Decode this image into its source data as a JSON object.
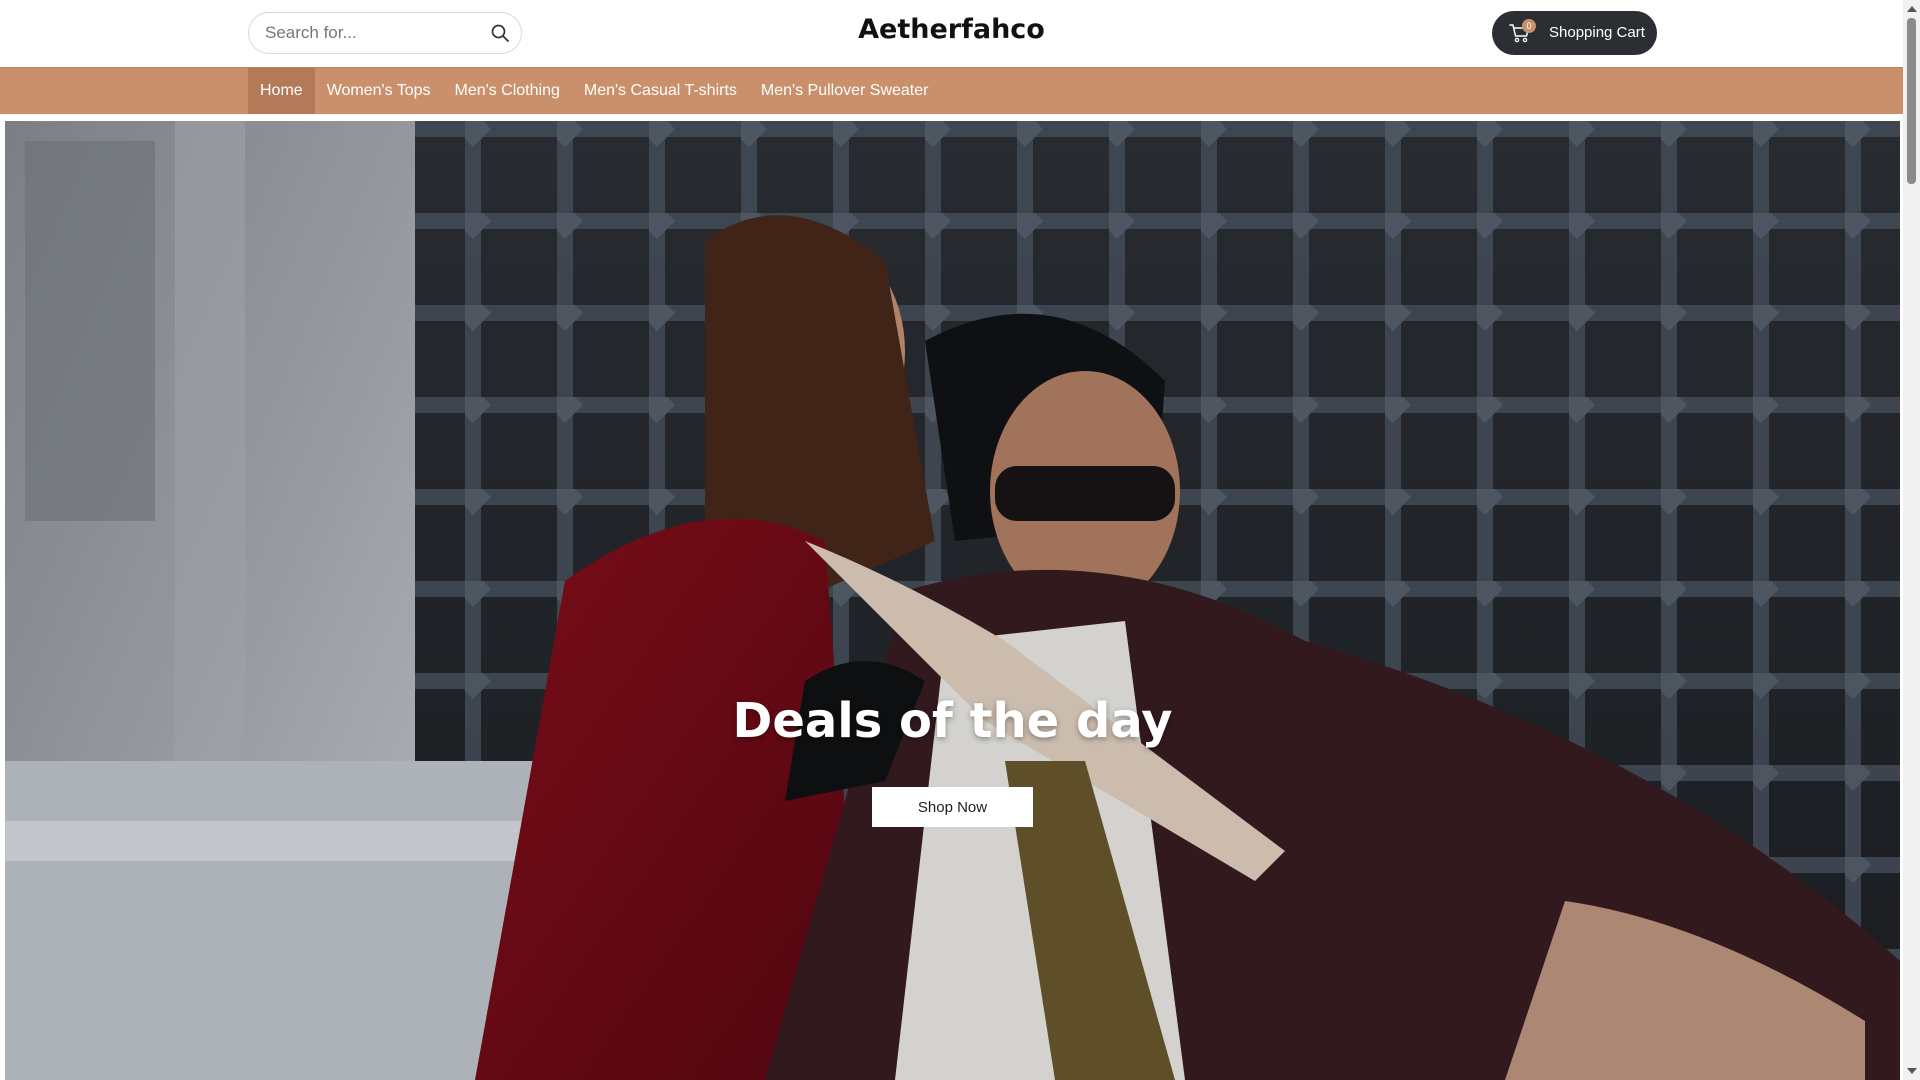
{
  "header": {
    "search": {
      "placeholder": "Search for...",
      "value": "",
      "icon": "search-icon"
    },
    "brand": "Aetherfahco",
    "cart": {
      "label": "Shopping Cart",
      "count": "0",
      "icon": "cart-icon"
    }
  },
  "nav": {
    "items": [
      {
        "label": "Home",
        "active": true
      },
      {
        "label": "Women's Tops",
        "active": false
      },
      {
        "label": "Men's Clothing",
        "active": false
      },
      {
        "label": "Men's Casual T-shirts",
        "active": false
      },
      {
        "label": "Men's Pullover Sweater",
        "active": false
      }
    ]
  },
  "hero": {
    "title": "Deals of the day",
    "cta_label": "Shop Now",
    "image": "fashion-banner-photo"
  },
  "colors": {
    "nav_background": "#c9906b",
    "nav_active": "#b37a59",
    "cart_button": "#2b2f33",
    "badge": "#c9906b"
  }
}
